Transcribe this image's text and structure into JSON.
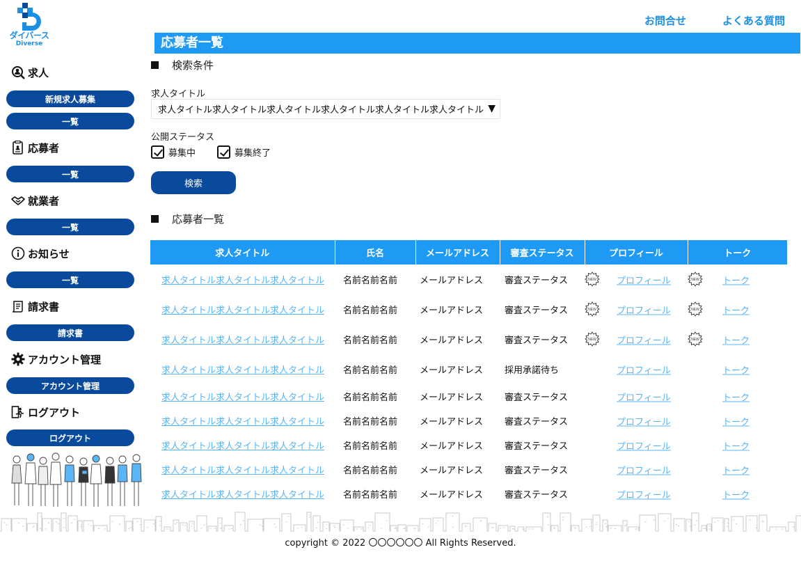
{
  "brand": {
    "name": "ダイバース",
    "sub": "Diverse",
    "color": "#1a8fe3"
  },
  "top_nav": {
    "contact": "お問合せ",
    "faq": "よくある質問"
  },
  "sidebar": {
    "sections": [
      {
        "icon": "search-person-icon",
        "label": "求人",
        "buttons": [
          "新規求人募集",
          "一覧"
        ]
      },
      {
        "icon": "document-icon",
        "label": "応募者",
        "buttons": [
          "一覧"
        ]
      },
      {
        "icon": "handshake-icon",
        "label": "就業者",
        "buttons": [
          "一覧"
        ]
      },
      {
        "icon": "info-icon",
        "label": "お知らせ",
        "buttons": [
          "一覧"
        ]
      },
      {
        "icon": "invoice-icon",
        "label": "請求書",
        "buttons": [
          "請求書"
        ]
      },
      {
        "icon": "gear-icon",
        "label": "アカウント管理",
        "buttons": [
          "アカウント管理"
        ]
      },
      {
        "icon": "logout-icon",
        "label": "ログアウト",
        "buttons": [
          "ログアウト"
        ]
      }
    ]
  },
  "page": {
    "title": "応募者一覧"
  },
  "search": {
    "heading": "検索条件",
    "job_title_label": "求人タイトル",
    "job_title_value": "求人タイトル求人タイトル求人タイトル求人タイトル求人タイトル求人タイトル",
    "status_label": "公開ステータス",
    "checkboxes": [
      {
        "label": "募集中",
        "checked": true
      },
      {
        "label": "募集終了",
        "checked": true
      }
    ],
    "button": "検索"
  },
  "list": {
    "heading": "応募者一覧",
    "columns": [
      "求人タイトル",
      "氏名",
      "メールアドレス",
      "審査ステータス",
      "プロフィール",
      "トーク"
    ],
    "rows": [
      {
        "title": "求人タイトル求人タイトル求人タイトル",
        "name": "名前名前名前",
        "email": "メールアドレス",
        "status": "審査ステータス",
        "profile": "プロフィール",
        "talk": "トーク",
        "profile_new": true,
        "talk_new": true
      },
      {
        "title": "求人タイトル求人タイトル求人タイトル",
        "name": "名前名前名前",
        "email": "メールアドレス",
        "status": "審査ステータス",
        "profile": "プロフィール",
        "talk": "トーク",
        "profile_new": true,
        "talk_new": true
      },
      {
        "title": "求人タイトル求人タイトル求人タイトル",
        "name": "名前名前名前",
        "email": "メールアドレス",
        "status": "審査ステータス",
        "profile": "プロフィール",
        "talk": "トーク",
        "profile_new": true,
        "talk_new": true
      },
      {
        "title": "求人タイトル求人タイトル求人タイトル",
        "name": "名前名前名前",
        "email": "メールアドレス",
        "status": "採用承諾待ち",
        "profile": "プロフィール",
        "talk": "トーク",
        "profile_new": false,
        "talk_new": false
      },
      {
        "title": "求人タイトル求人タイトル求人タイトル",
        "name": "名前名前名前",
        "email": "メールアドレス",
        "status": "審査ステータス",
        "profile": "プロフィール",
        "talk": "トーク",
        "profile_new": false,
        "talk_new": false
      },
      {
        "title": "求人タイトル求人タイトル求人タイトル",
        "name": "名前名前名前",
        "email": "メールアドレス",
        "status": "審査ステータス",
        "profile": "プロフィール",
        "talk": "トーク",
        "profile_new": false,
        "talk_new": false
      },
      {
        "title": "求人タイトル求人タイトル求人タイトル",
        "name": "名前名前名前",
        "email": "メールアドレス",
        "status": "審査ステータス",
        "profile": "プロフィール",
        "talk": "トーク",
        "profile_new": false,
        "talk_new": false
      },
      {
        "title": "求人タイトル求人タイトル求人タイトル",
        "name": "名前名前名前",
        "email": "メールアドレス",
        "status": "審査ステータス",
        "profile": "プロフィール",
        "talk": "トーク",
        "profile_new": false,
        "talk_new": false
      },
      {
        "title": "求人タイトル求人タイトル求人タイトル",
        "name": "名前名前名前",
        "email": "メールアドレス",
        "status": "審査ステータス",
        "profile": "プロフィール",
        "talk": "トーク",
        "profile_new": false,
        "talk_new": false
      }
    ],
    "new_badge_text": "NEW"
  },
  "footer": {
    "copyright": "copyright © 2022 〇〇〇〇〇〇 All Rights Reserved."
  },
  "colors": {
    "primary": "#1e9af5",
    "navy": "#0a4a9c",
    "link": "#5ab4f6"
  }
}
